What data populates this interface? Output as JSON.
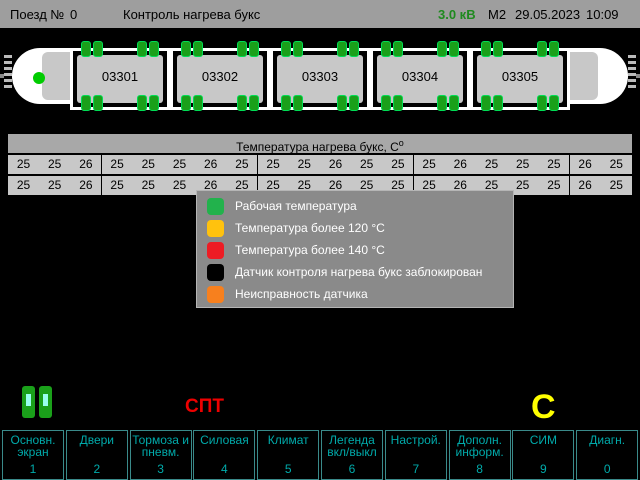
{
  "header": {
    "train_label": "Поезд №",
    "train_number": "0",
    "screen_title": "Контроль нагрева букс",
    "voltage": "3.0 кВ",
    "mode": "М2",
    "date": "29.05.2023",
    "time": "10:09",
    "voltage_color": "#1f8a1f"
  },
  "cars": [
    "03301",
    "03302",
    "03303",
    "03304",
    "03305"
  ],
  "temperature": {
    "title": "Температура нагрева букс, С",
    "degree": "o",
    "row1": [
      "25",
      "25",
      "26",
      "25",
      "25",
      "25",
      "26",
      "25",
      "25",
      "25",
      "26",
      "25",
      "25",
      "25",
      "26",
      "25",
      "25",
      "25",
      "26",
      "25"
    ],
    "row2": [
      "25",
      "25",
      "26",
      "25",
      "25",
      "25",
      "26",
      "25",
      "25",
      "25",
      "26",
      "25",
      "25",
      "25",
      "26",
      "25",
      "25",
      "25",
      "26",
      "25"
    ]
  },
  "legend": [
    {
      "label": "Рабочая температура",
      "color": "#22b24c"
    },
    {
      "label": "Температура более 120 °С",
      "color": "#ffc20e"
    },
    {
      "label": "Температура более 140 °С",
      "color": "#ed1c24"
    },
    {
      "label": "Датчик контроля нагрева букс заблокирован",
      "color": "#000000"
    },
    {
      "label": "Неисправность датчика",
      "color": "#f7801e"
    }
  ],
  "indicators": {
    "spt": "СПТ",
    "c": "С"
  },
  "buttons": [
    {
      "label": "Основн. экран",
      "num": "1"
    },
    {
      "label": "Двери",
      "num": "2"
    },
    {
      "label": "Тормоза и пневм.",
      "num": "3"
    },
    {
      "label": "Силовая",
      "num": "4"
    },
    {
      "label": "Климат",
      "num": "5"
    },
    {
      "label": "Легенда вкл/выкл",
      "num": "6"
    },
    {
      "label": "Настрой.",
      "num": "7"
    },
    {
      "label": "Дополн. информ.",
      "num": "8"
    },
    {
      "label": "СИМ",
      "num": "9"
    },
    {
      "label": "Диагн.",
      "num": "0"
    }
  ]
}
